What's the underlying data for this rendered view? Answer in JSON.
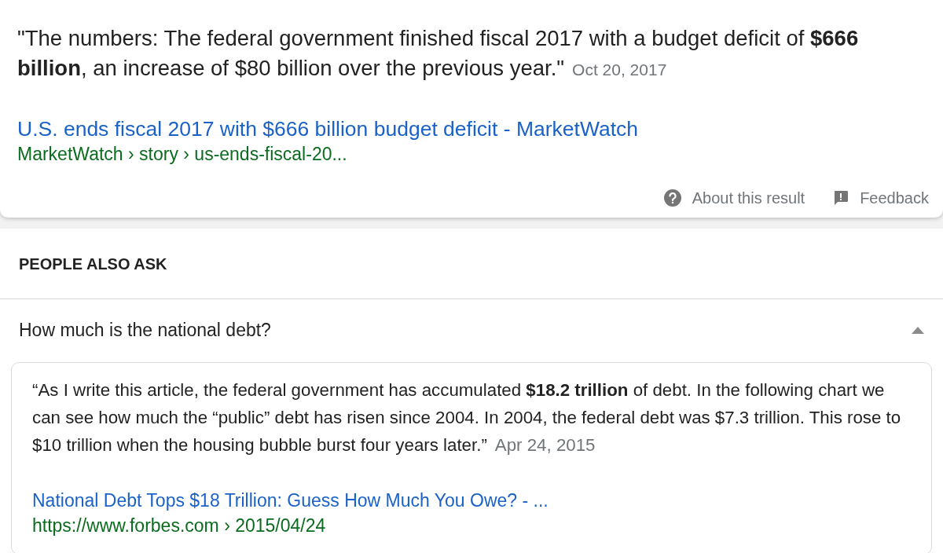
{
  "snippet": {
    "quote": "\"The numbers: The federal government finished fiscal 2017 with a budget deficit of **$666 billion**, an increase of $80 billion over the previous year.\"",
    "date": "Oct 20, 2017",
    "link_title": "U.S. ends fiscal 2017 with $666 billion budget deficit - MarketWatch",
    "breadcrumb": "MarketWatch › story › us-ends-fiscal-20...",
    "footer": [
      {
        "kind": "about",
        "label": "About this result"
      },
      {
        "kind": "feedback",
        "label": "Feedback"
      }
    ]
  },
  "people_also_ask": {
    "heading": "PEOPLE ALSO ASK",
    "questions": [
      {
        "question": "How much is the national debt?",
        "expanded": true,
        "answer": {
          "open_quote": "“",
          "quote": "As I write this article, the federal government has accumulated **$18.2 trillion** of debt. In the following chart we can see how much the “public” debt has risen since 2004. In 2004, the federal debt was $7.3 trillion. This rose to $10 trillion when the housing bubble burst four years later.",
          "close_quote": "”",
          "date": "Apr 24, 2015",
          "link_title": "National Debt Tops $18 Trillion: Guess How Much You Owe? - ...",
          "url": "https://www.forbes.com › 2015/04/24"
        }
      }
    ]
  }
}
